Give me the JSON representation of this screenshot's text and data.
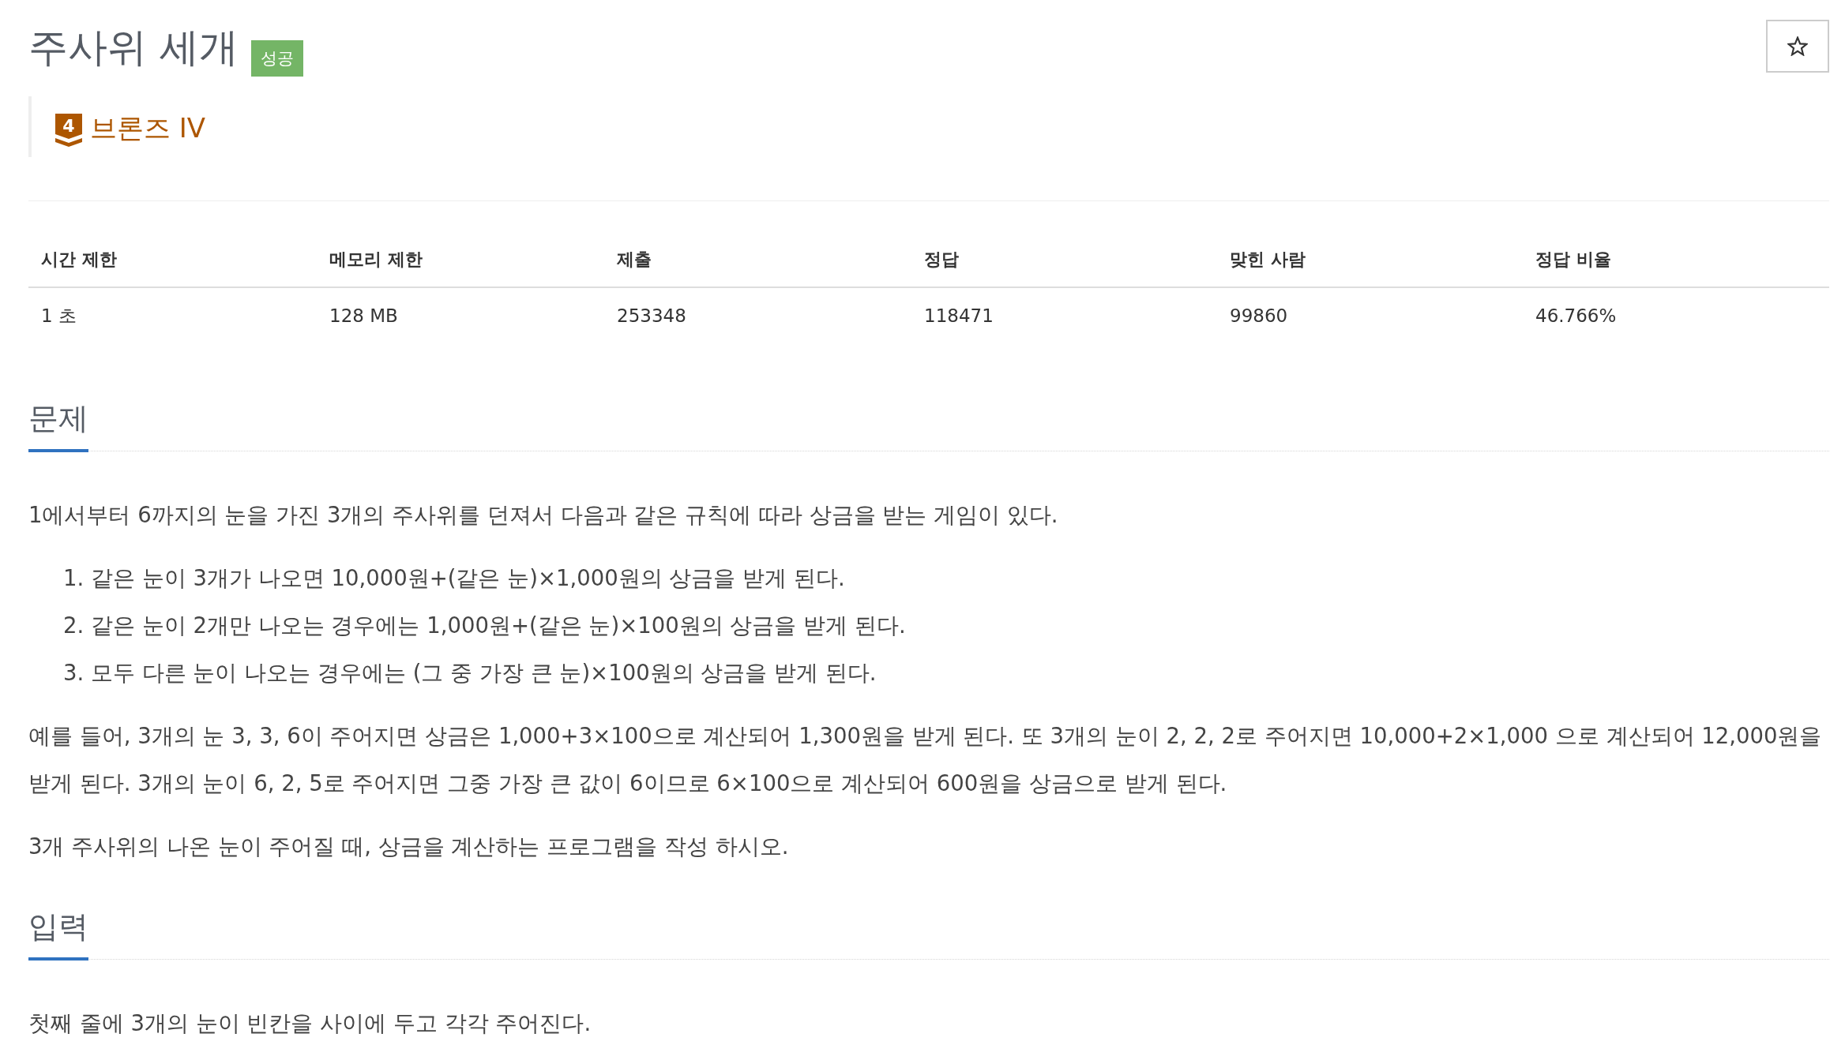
{
  "problem": {
    "title": "주사위 세개",
    "result_badge": "성공",
    "starred": false
  },
  "tier": {
    "number": "4",
    "name": "브론즈 IV"
  },
  "info_table": {
    "columns": [
      "시간 제한",
      "메모리 제한",
      "제출",
      "정답",
      "맞힌 사람",
      "정답 비율"
    ],
    "rows": [
      [
        "1 초",
        "128 MB",
        "253348",
        "118471",
        "99860",
        "46.766%"
      ]
    ]
  },
  "sections": [
    {
      "heading": "문제",
      "blocks": [
        {
          "kind": "paragraph",
          "text": "1에서부터 6까지의 눈을 가진 3개의 주사위를 던져서 다음과 같은 규칙에 따라 상금을 받는 게임이 있다."
        },
        {
          "kind": "ordered_list",
          "items": [
            {
              "number": "1.",
              "text": "같은 눈이 3개가 나오면 10,000원+(같은 눈)×1,000원의 상금을 받게 된다."
            },
            {
              "number": "2.",
              "text": "같은 눈이 2개만 나오는 경우에는 1,000원+(같은 눈)×100원의 상금을 받게 된다."
            },
            {
              "number": "3.",
              "text": "모두 다른 눈이 나오는 경우에는 (그 중 가장 큰 눈)×100원의 상금을 받게 된다."
            }
          ]
        },
        {
          "kind": "paragraph",
          "text": "예를 들어, 3개의 눈 3, 3, 6이 주어지면 상금은 1,000+3×100으로 계산되어 1,300원을 받게 된다. 또 3개의 눈이 2, 2, 2로 주어지면 10,000+2×1,000 으로 계산되어 12,000원을 받게 된다. 3개의 눈이 6, 2, 5로 주어지면 그중 가장 큰 값이 6이므로 6×100으로 계산되어 600원을 상금으로 받게 된다."
        },
        {
          "kind": "paragraph",
          "text": "3개 주사위의 나온 눈이 주어질 때, 상금을 계산하는 프로그램을 작성 하시오."
        }
      ]
    },
    {
      "heading": "입력",
      "blocks": [
        {
          "kind": "paragraph",
          "text": "첫째 줄에 3개의 눈이 빈칸을 사이에 두고 각각 주어진다."
        }
      ]
    }
  ]
}
